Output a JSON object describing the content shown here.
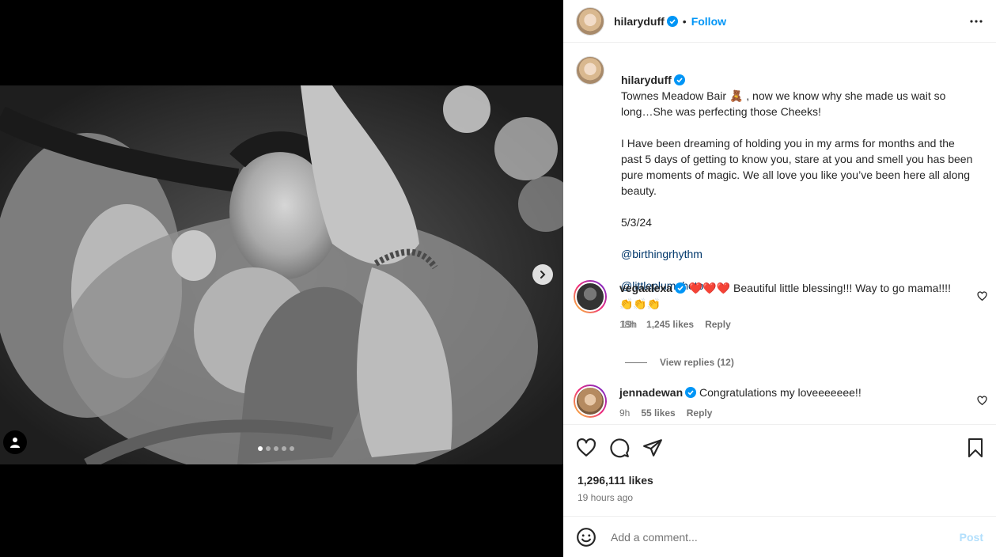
{
  "header": {
    "username": "hilaryduff",
    "separator": "•",
    "follow_label": "Follow"
  },
  "caption": {
    "username": "hilaryduff",
    "text": "Townes Meadow Bair 🧸 , now we know why she made us wait so long…She was perfecting those Cheeks!\n\nI Have been dreaming of holding you in my arms for months and the past 5 days of getting to know you, stare at you and smell you has been pure moments of magic. We all love you like you’ve been here all along beauty.\n\n5/3/24\n",
    "mentions": [
      "@birthingrhythm",
      "@littleplumphoto"
    ],
    "time": "19h"
  },
  "comments": [
    {
      "username": "vegaalexa",
      "text": "❤️❤️❤️ Beautiful little blessing!!! Way to go mama!!!! 👏👏👏",
      "time": "18h",
      "likes": "1,245 likes",
      "reply_label": "Reply",
      "view_replies": "View replies (12)"
    },
    {
      "username": "jennadewan",
      "text": "Congratulations my loveeeeeee!!",
      "time": "9h",
      "likes": "55 likes",
      "reply_label": "Reply"
    }
  ],
  "post_stats": {
    "likes": "1,296,111 likes",
    "ago": "19 hours ago"
  },
  "comment_box": {
    "placeholder": "Add a comment...",
    "post_label": "Post"
  },
  "carousel": {
    "total": 5,
    "current": 1
  },
  "icons": [
    "more-icon",
    "heart-icon",
    "comment-icon",
    "share-icon",
    "bookmark-icon",
    "emoji-icon",
    "verified-icon",
    "chevron-right-icon",
    "user-tag-icon"
  ],
  "colors": {
    "accent": "#0095f6",
    "mention": "#00376b",
    "muted": "#737373",
    "post_disabled": "#b2dffc"
  }
}
